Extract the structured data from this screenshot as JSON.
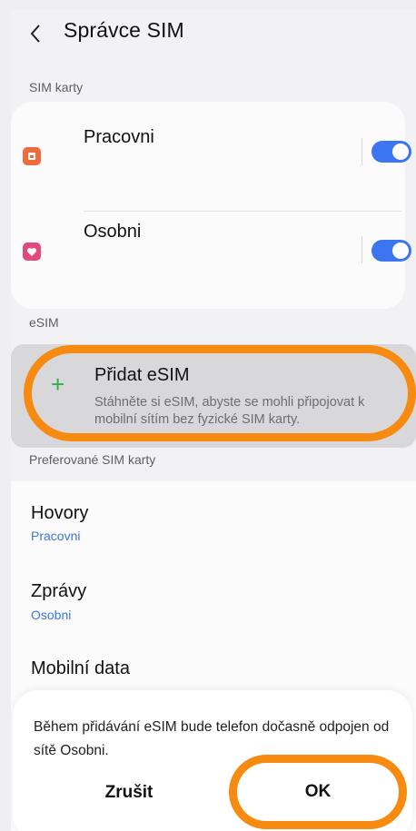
{
  "header": {
    "title": "Správce SIM"
  },
  "sim_section": {
    "label": "SIM karty",
    "items": [
      {
        "name": "Pracovni",
        "icon": "sim-card-icon",
        "icon_color": "#ef6a3c",
        "enabled": true
      },
      {
        "name": "Osobni",
        "icon": "heart-sim-icon",
        "icon_color": "#e5487a",
        "enabled": true
      }
    ]
  },
  "esim_section": {
    "label": "eSIM",
    "add": {
      "title": "Přidat eSIM",
      "description": "Stáhněte si eSIM, abyste se mohli připojovat k mobilní sítím bez fyzické SIM karty."
    }
  },
  "preferred": {
    "label": "Preferované SIM karty",
    "items": [
      {
        "title": "Hovory",
        "value": "Pracovni"
      },
      {
        "title": "Zprávy",
        "value": "Osobni"
      },
      {
        "title": "Mobilní data",
        "value": ""
      }
    ]
  },
  "dialog": {
    "message": "Během přidávání eSIM bude telefon dočasně odpojen od sítě Osobni.",
    "cancel": "Zrušit",
    "ok": "OK"
  },
  "colors": {
    "accent": "#3b75f0",
    "highlight": "#f78b11",
    "link": "#3d77d8",
    "plus": "#2fae4d"
  }
}
